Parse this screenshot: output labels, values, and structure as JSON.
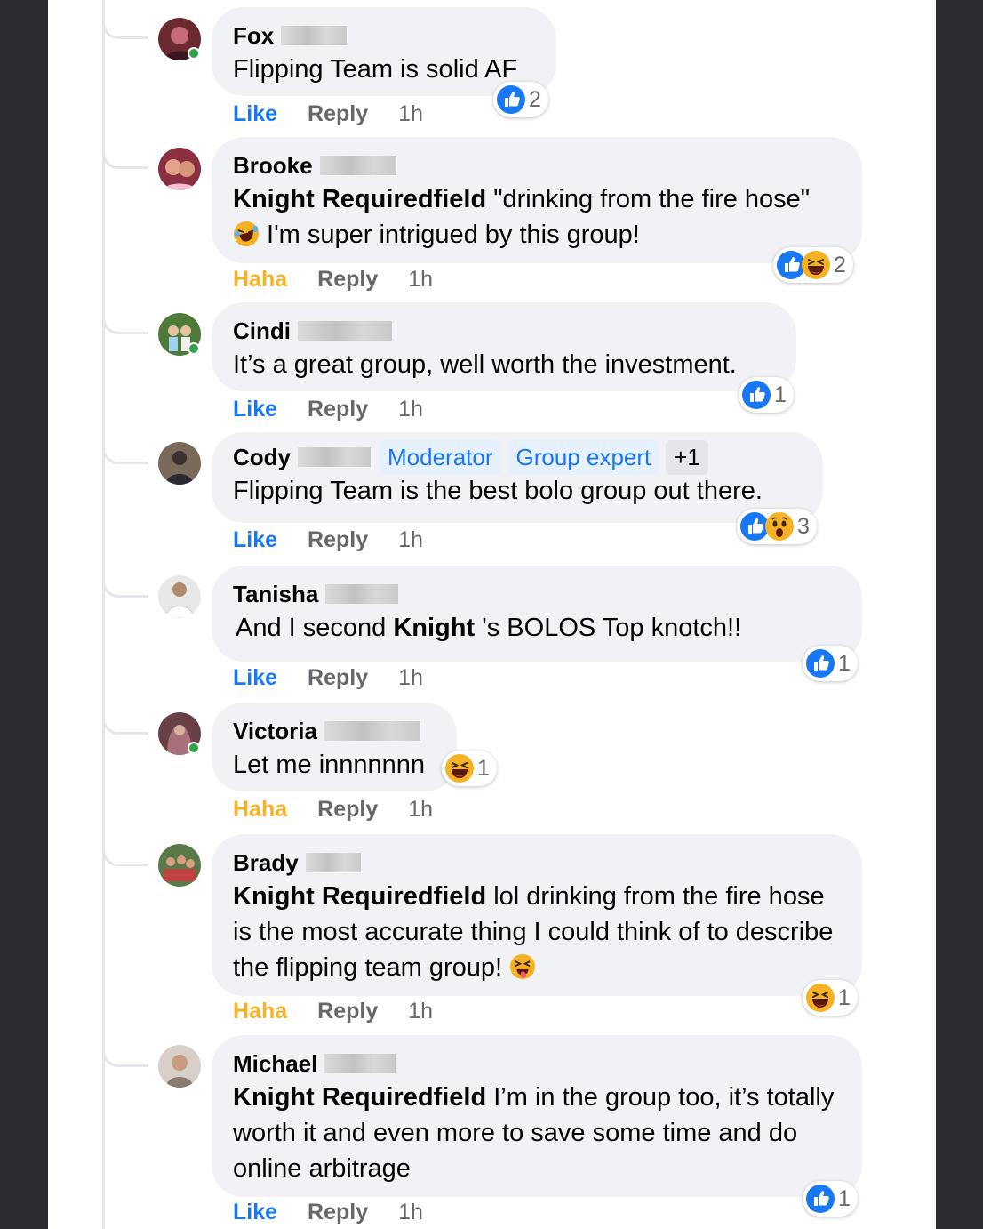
{
  "comments": [
    {
      "author": "Fox",
      "mention": "",
      "text": "Flipping Team is solid AF",
      "reaction_action": "Like",
      "reply": "Reply",
      "time": "1h",
      "reaction_count": "2",
      "reaction_icons": [
        "like-icon"
      ]
    },
    {
      "author": "Brooke",
      "mention": "Knight Requiredfield",
      "text": " \"drinking from the fire hose\" ",
      "text_after_emoji": " I'm super intrigued by this group!",
      "reaction_action": "Haha",
      "reply": "Reply",
      "time": "1h",
      "reaction_count": "2",
      "reaction_icons": [
        "like-icon",
        "haha-icon"
      ]
    },
    {
      "author": "Cindi",
      "mention": "",
      "text": "It’s a great group, well worth the investment.",
      "reaction_action": "Like",
      "reply": "Reply",
      "time": "1h",
      "reaction_count": "1",
      "reaction_icons": [
        "like-icon"
      ]
    },
    {
      "author": "Cody",
      "badges": [
        "Moderator",
        "Group expert",
        "+1"
      ],
      "mention": "",
      "text": "Flipping Team is the best bolo group out there.",
      "reaction_action": "Like",
      "reply": "Reply",
      "time": "1h",
      "reaction_count": "3",
      "reaction_icons": [
        "like-icon",
        "wow-icon"
      ]
    },
    {
      "author": "Tanisha",
      "text_before": "And I second ",
      "mention": "Knight",
      "text": " 's BOLOS Top knotch!!",
      "reaction_action": "Like",
      "reply": "Reply",
      "time": "1h",
      "reaction_count": "1",
      "reaction_icons": [
        "like-icon"
      ]
    },
    {
      "author": "Victoria",
      "mention": "",
      "text": "Let me innnnnnn",
      "reaction_action": "Haha",
      "reply": "Reply",
      "time": "1h",
      "reaction_count": "1",
      "reaction_icons": [
        "haha-icon"
      ]
    },
    {
      "author": "Brady",
      "mention": "Knight Requiredfield",
      "text": " lol drinking from the fire hose is the most accurate thing I could think of to describe the flipping team group! ",
      "reaction_action": "Haha",
      "reply": "Reply",
      "time": "1h",
      "reaction_count": "1",
      "reaction_icons": [
        "haha-icon"
      ]
    },
    {
      "author": "Michael",
      "mention": "Knight Requiredfield",
      "text": " I’m in the group too, it’s totally worth it and even more to save some time and do online arbitrage",
      "reaction_action": "Like",
      "reply": "Reply",
      "time": "1h",
      "reaction_count": "1",
      "reaction_icons": [
        "like-icon"
      ]
    }
  ],
  "colors": {
    "like_blue": "#1877f2",
    "haha_yellow": "#f7b125",
    "bubble_bg": "#f0f2f5",
    "online_green": "#31a24c"
  }
}
